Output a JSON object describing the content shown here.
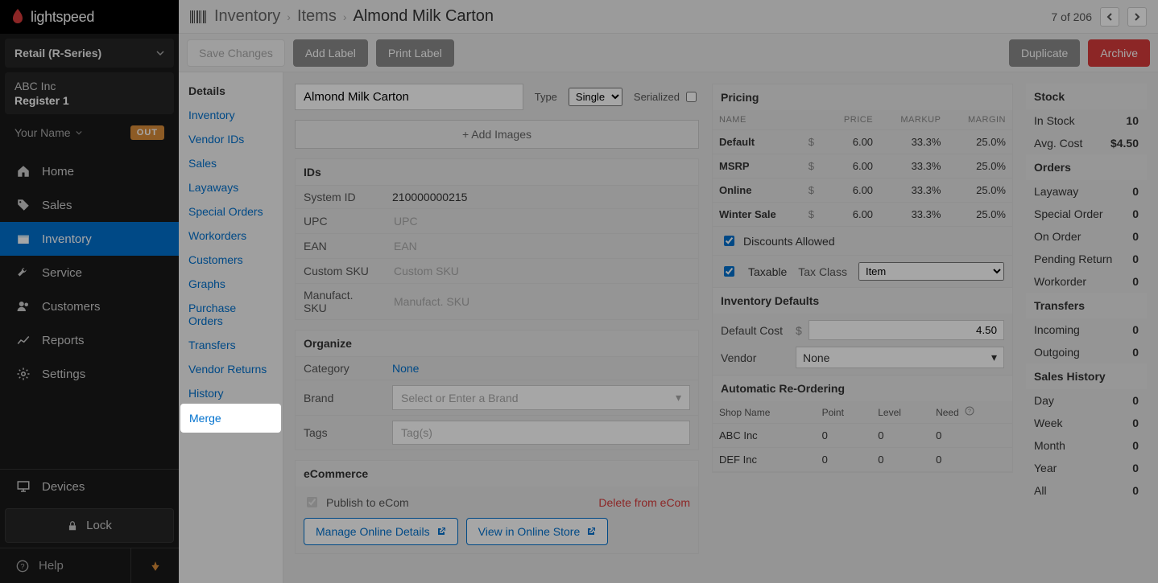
{
  "brand": {
    "name": "lightspeed"
  },
  "store_selector": "Retail (R-Series)",
  "company": {
    "name": "ABC Inc",
    "register": "Register 1"
  },
  "user": {
    "name": "Your Name",
    "badge": "OUT"
  },
  "nav": {
    "home": "Home",
    "sales": "Sales",
    "inventory": "Inventory",
    "service": "Service",
    "customers": "Customers",
    "reports": "Reports",
    "settings": "Settings",
    "devices": "Devices",
    "lock": "Lock",
    "help": "Help"
  },
  "breadcrumb": {
    "root": "Inventory",
    "items": "Items",
    "current": "Almond Milk Carton"
  },
  "counter": "7 of 206",
  "actions": {
    "save": "Save Changes",
    "add_label": "Add Label",
    "print_label": "Print Label",
    "duplicate": "Duplicate",
    "archive": "Archive"
  },
  "subnav": {
    "details": "Details",
    "inventory": "Inventory",
    "vendor_ids": "Vendor IDs",
    "sales": "Sales",
    "layaways": "Layaways",
    "special_orders": "Special Orders",
    "workorders": "Workorders",
    "customers": "Customers",
    "graphs": "Graphs",
    "purchase_orders": "Purchase Orders",
    "transfers": "Transfers",
    "vendor_returns": "Vendor Returns",
    "history": "History",
    "merge": "Merge"
  },
  "item": {
    "title": "Almond Milk Carton",
    "type_label": "Type",
    "type_value": "Single",
    "serialized_label": "Serialized"
  },
  "images": {
    "add": "+ Add Images"
  },
  "ids": {
    "header": "IDs",
    "system_id_label": "System ID",
    "system_id": "210000000215",
    "upc_label": "UPC",
    "upc_placeholder": "UPC",
    "ean_label": "EAN",
    "ean_placeholder": "EAN",
    "custom_sku_label": "Custom SKU",
    "custom_sku_placeholder": "Custom SKU",
    "manufact_sku_label": "Manufact. SKU",
    "manufact_sku_placeholder": "Manufact. SKU"
  },
  "organize": {
    "header": "Organize",
    "category_label": "Category",
    "category_value": "None",
    "brand_label": "Brand",
    "brand_placeholder": "Select or Enter a Brand",
    "tags_label": "Tags",
    "tags_placeholder": "Tag(s)"
  },
  "ecom": {
    "header": "eCommerce",
    "publish_label": "Publish to eCom",
    "delete_link": "Delete from eCom",
    "manage_btn": "Manage Online Details",
    "view_btn": "View in Online Store"
  },
  "pricing": {
    "header": "Pricing",
    "cols": {
      "name": "NAME",
      "price": "PRICE",
      "markup": "MARKUP",
      "margin": "MARGIN"
    },
    "currency": "$",
    "rows": [
      {
        "name": "Default",
        "price": "6.00",
        "markup": "33.3%",
        "margin": "25.0%"
      },
      {
        "name": "MSRP",
        "price": "6.00",
        "markup": "33.3%",
        "margin": "25.0%"
      },
      {
        "name": "Online",
        "price": "6.00",
        "markup": "33.3%",
        "margin": "25.0%"
      },
      {
        "name": "Winter Sale",
        "price": "6.00",
        "markup": "33.3%",
        "margin": "25.0%"
      }
    ],
    "discounts_allowed": "Discounts Allowed",
    "taxable": "Taxable",
    "tax_class_label": "Tax Class",
    "tax_class_value": "Item"
  },
  "inv_defaults": {
    "header": "Inventory Defaults",
    "default_cost_label": "Default Cost",
    "default_cost": "4.50",
    "vendor_label": "Vendor",
    "vendor_value": "None"
  },
  "reorder": {
    "header": "Automatic Re-Ordering",
    "cols": {
      "shop": "Shop Name",
      "point": "Point",
      "level": "Level",
      "need": "Need"
    },
    "rows": [
      {
        "shop": "ABC Inc",
        "point": "0",
        "level": "0",
        "need": "0"
      },
      {
        "shop": "DEF Inc",
        "point": "0",
        "level": "0",
        "need": "0"
      }
    ]
  },
  "stock": {
    "header": "Stock",
    "in_stock_label": "In Stock",
    "in_stock": "10",
    "avg_cost_label": "Avg. Cost",
    "avg_cost": "$4.50"
  },
  "orders": {
    "header": "Orders",
    "layaway_label": "Layaway",
    "layaway": "0",
    "special_label": "Special Order",
    "special": "0",
    "on_order_label": "On Order",
    "on_order": "0",
    "pending_label": "Pending Return",
    "pending": "0",
    "workorder_label": "Workorder",
    "workorder": "0"
  },
  "transfers": {
    "header": "Transfers",
    "incoming_label": "Incoming",
    "incoming": "0",
    "outgoing_label": "Outgoing",
    "outgoing": "0"
  },
  "sales_history": {
    "header": "Sales History",
    "day_label": "Day",
    "day": "0",
    "week_label": "Week",
    "week": "0",
    "month_label": "Month",
    "month": "0",
    "year_label": "Year",
    "year": "0",
    "all_label": "All",
    "all": "0"
  }
}
